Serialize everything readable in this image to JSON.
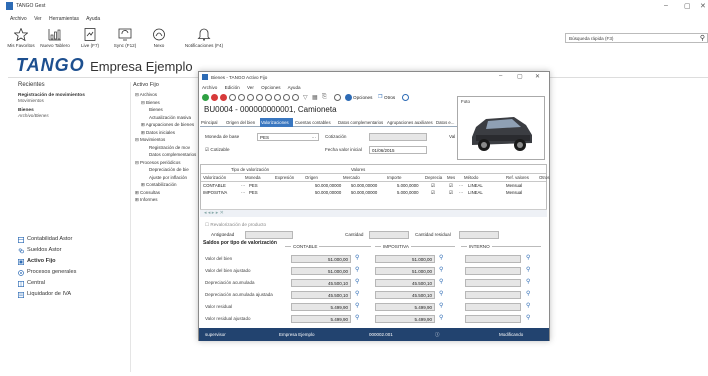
{
  "app": {
    "title": "TANGO Gest",
    "menu": [
      "Archivo",
      "Ver",
      "Herramientas",
      "Ayuda"
    ],
    "ribbon": [
      {
        "label": "Mis Favoritos",
        "icon": "star-icon"
      },
      {
        "label": "Nuevo Tablero",
        "icon": "dashboard-icon"
      },
      {
        "label": "Live (F7)",
        "icon": "live-icon"
      },
      {
        "label": "Sync (F12)",
        "icon": "sync-icon"
      },
      {
        "label": "Nexo",
        "icon": "nexo-icon"
      },
      {
        "label": "Notificaciones (F4)",
        "icon": "bell-icon"
      }
    ],
    "search_placeholder": "Búsqueda rápida (F3)",
    "brand_logo": "TANGO",
    "brand_name": "Empresa Ejemplo"
  },
  "recientes": {
    "heading": "Recientes",
    "item_title": "Registración de movimientos",
    "item_sub": "Movimientos",
    "item2_title": "Bienes",
    "item2_sub": "Archivo/Bienes"
  },
  "tree": {
    "heading": "Activo Fijo",
    "items": [
      "Archivos",
      "Bienes",
      "Bienes",
      "Actualización masiva",
      "Agrupaciones de bienes",
      "Datos iniciales",
      "Movimientos",
      "Registración de mov",
      "Datos complementarios",
      "Procesos periódicos",
      "Depreciación de bie",
      "Ajuste por inflación",
      "Contabilización",
      "Consultas",
      "Informes"
    ]
  },
  "nav": [
    {
      "label": "Contabilidad Astor",
      "icon": "ledger-icon"
    },
    {
      "label": "Sueldos Astor",
      "icon": "payroll-icon"
    },
    {
      "label": "Activo Fijo",
      "icon": "asset-icon",
      "selected": true
    },
    {
      "label": "Procesos generales",
      "icon": "process-icon"
    },
    {
      "label": "Central",
      "icon": "central-icon"
    },
    {
      "label": "Liquidador de IVA",
      "icon": "tax-icon"
    }
  ],
  "window": {
    "title": "Bienes - TANGO Activo Fijo",
    "menu": [
      "Archivo",
      "Edición",
      "Ver",
      "Opciones",
      "Ayuda"
    ],
    "opciones_btn": "Opciones",
    "otros_btn": "Otros",
    "record_title": "BU0004 - 000000000001, Camioneta",
    "tabs": [
      "Principal",
      "Origen del bien",
      "Valorizaciones",
      "Cuentas contables",
      "Datos complementarios",
      "Agrupaciones auxiliares",
      "Datos e..."
    ],
    "foto_label": "Foto",
    "moneda_label": "Moneda de base",
    "moneda_value": "PES",
    "cotizacion_label": "Cotización",
    "vi_label": "Val",
    "cotizable_label": "Cotizable",
    "fecha_label": "Fecha valor inicial",
    "fecha_value": "01/06/2015",
    "grid": {
      "group_tipo": "Tipo de valorización",
      "group_valores": "Valores",
      "headers": [
        "Valorización",
        "Moneda",
        "Expresión",
        "Origen",
        "Mercado",
        "Importe",
        "Deprecia",
        "Mes",
        "Método",
        "Ref. valores",
        "Otros"
      ],
      "rows": [
        [
          "CONTABLE",
          "PES",
          "",
          "50.000,00000",
          "50.000,00000",
          "5.000,0000",
          "",
          "",
          "LINEAL",
          "Mensual"
        ],
        [
          "IMPOSITIVA",
          "PES",
          "",
          "50.000,00000",
          "50.000,00000",
          "5.000,0000",
          "",
          "",
          "LINEAL",
          "Mensual"
        ]
      ]
    },
    "revalorizacion_label": "Revalorización de producto",
    "antiguedad_label": "Antigüedad",
    "cantidad_label": "Cantidad",
    "cantidad_residual_label": "Cantidad residual",
    "saldos_heading": "Saldos por tipo de valorización",
    "col_contable": "CONTABLE",
    "col_impositiva": "IMPOSITIVA",
    "col_interno": "INTERNO",
    "saldo_rows": [
      {
        "label": "Valor del bien",
        "contable": "51.000,00",
        "impositiva": "51.000,00"
      },
      {
        "label": "Valor del bien ajustado",
        "contable": "51.000,00",
        "impositiva": "51.000,00"
      },
      {
        "label": "Depreciación acumulada",
        "contable": "45.500,10",
        "impositiva": "45.500,10"
      },
      {
        "label": "Depreciación acumulada ajustada",
        "contable": "45.500,10",
        "impositiva": "45.500,10"
      },
      {
        "label": "Valor residual",
        "contable": "5.499,90",
        "impositiva": "5.499,90"
      },
      {
        "label": "Valor residual ajustado",
        "contable": "5.499,90",
        "impositiva": "5.499,90"
      }
    ],
    "status": {
      "user": "supervisor",
      "company": "Empresa Ejemplo",
      "version": "000002.001",
      "mode": "Modificando"
    }
  }
}
